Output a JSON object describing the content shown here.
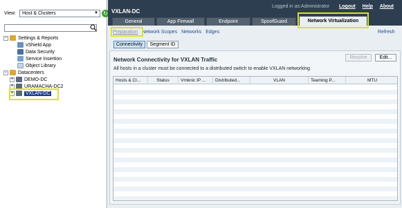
{
  "left_panel": {
    "view_label": "View:",
    "view_value": "Host & Clusters",
    "search_placeholder": "",
    "tree": {
      "settings": "Settings & Reports",
      "settings_children": [
        "vShield App",
        "Data Security",
        "Service Insertion",
        "Object Library"
      ],
      "datacenters": "Datacenters",
      "datacenter_children": [
        "DEMO-DC",
        "URAMACHA-DC2",
        "VXLAN-DC"
      ]
    }
  },
  "header": {
    "title": "VXLAN-DC",
    "logged_in": "Logged in as:Administrator",
    "links": [
      "Logout",
      "Help",
      "About"
    ]
  },
  "tabs": [
    "General",
    "App Firewall",
    "Endpoint",
    "SpoofGuard",
    "Network Virtualization"
  ],
  "active_tab": "Network Virtualization",
  "subnav": [
    "Preparation",
    "Network Scopes",
    "Networks",
    "Edges"
  ],
  "active_subnav": "Preparation",
  "refresh_label": "Refresh",
  "segment_tabs": [
    "Connectivity",
    "Segment ID"
  ],
  "section": {
    "title": "Network Connectivity for VXLAN Traffic",
    "resolve_label": "Resolve",
    "edit_label": "Edit...",
    "info": "All hosts in a cluster must be connected to a distributed switch to enable VXLAN networking"
  },
  "table": {
    "columns": [
      "Hosts & Cl...",
      "Status",
      "Vmknic IP ...",
      "Distributed...",
      "VLAN",
      "Teaming P...",
      "MTU"
    ]
  },
  "colors": {
    "highlight": "#d8e61a",
    "topbar": "#2d3e50",
    "selected": "#1d3d8a"
  }
}
